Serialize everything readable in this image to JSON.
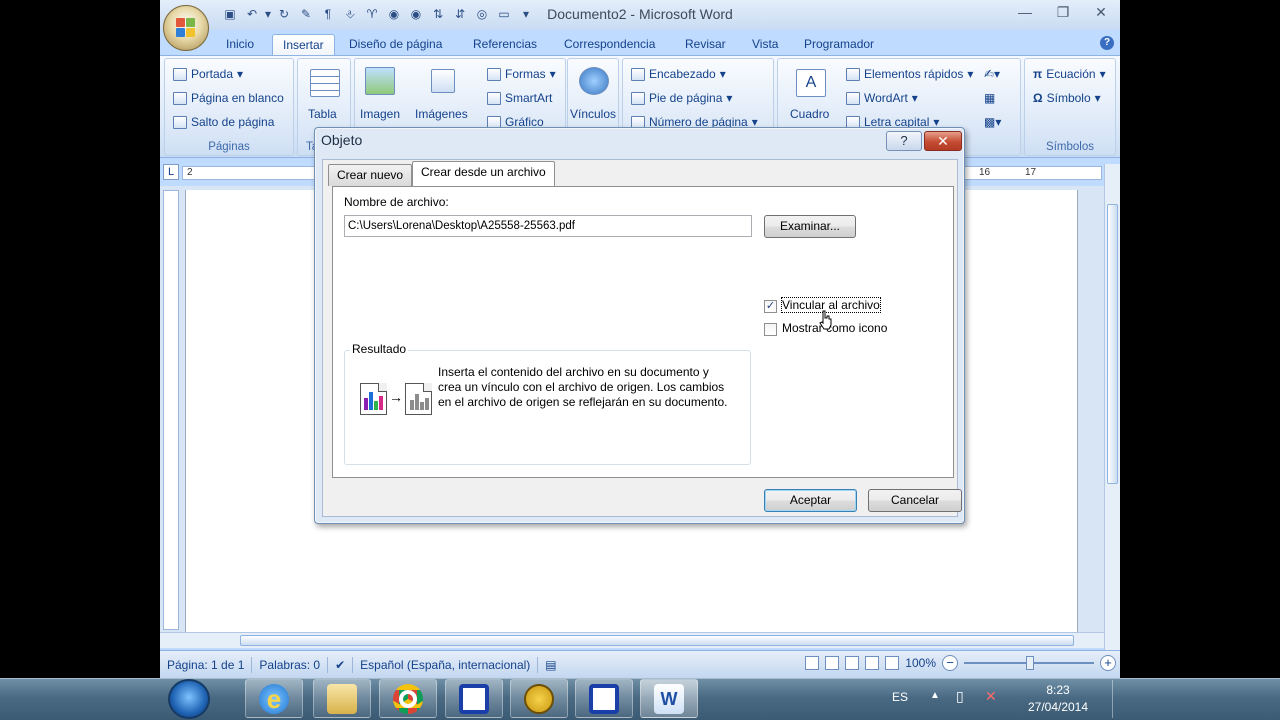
{
  "app": {
    "title": "Documento2 - Microsoft Word",
    "tabs": [
      "Inicio",
      "Insertar",
      "Diseño de página",
      "Referencias",
      "Correspondencia",
      "Revisar",
      "Vista",
      "Programador"
    ],
    "active_tab": "Insertar"
  },
  "ribbon": {
    "paginas": {
      "items": [
        "Portada",
        "Página en blanco",
        "Salto de página"
      ],
      "label": "Páginas"
    },
    "tabla": {
      "label": "Tabla",
      "group_label": "Ta"
    },
    "ilustraciones": {
      "imagen": "Imagen",
      "imagenes_pred": "Imágenes",
      "formas": "Formas",
      "smartart": "SmartArt",
      "grafico": "Gráfico"
    },
    "vinculos": "Vínculos",
    "encabezado": {
      "items": [
        "Encabezado",
        "Pie de página",
        "Número de página"
      ]
    },
    "texto": {
      "cuadro": "Cuadro",
      "items": [
        "Elementos rápidos",
        "WordArt",
        "Letra capital"
      ]
    },
    "simbolos": {
      "items": [
        "Ecuación",
        "Símbolo"
      ],
      "label": "Símbolos"
    }
  },
  "ruler": {
    "tab_selector": "L",
    "left_num": "2",
    "right_nums": [
      "16",
      "17"
    ]
  },
  "dialog": {
    "title": "Objeto",
    "help": "?",
    "close": "✕",
    "tabs": [
      "Crear nuevo",
      "Crear desde un archivo"
    ],
    "active_tab": "Crear desde un archivo",
    "filename_label": "Nombre de archivo:",
    "filename_value": "C:\\Users\\Lorena\\Desktop\\A25558-25563.pdf",
    "browse": "Examinar...",
    "link_label": "Vincular al archivo",
    "link_checked": true,
    "icon_label": "Mostrar como icono",
    "icon_checked": false,
    "result_label": "Resultado",
    "result_text": "Inserta el contenido del archivo en su documento y crea un vínculo con el archivo de origen. Los cambios en el archivo de origen se reflejarán en su documento.",
    "ok": "Aceptar",
    "cancel": "Cancelar"
  },
  "status": {
    "page": "Página: 1 de 1",
    "words": "Palabras: 0",
    "language": "Español (España, internacional)",
    "zoom": "100%"
  },
  "taskbar": {
    "lang": "ES",
    "time": "8:23",
    "date": "27/04/2014"
  },
  "colors": {
    "ribbon_bg": "#dbe8f7",
    "accent": "#15428b",
    "close_red": "#c44c33"
  }
}
